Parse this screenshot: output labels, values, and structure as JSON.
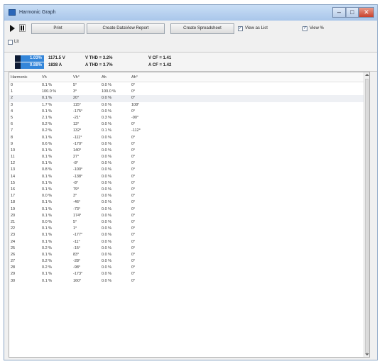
{
  "window": {
    "title": "Harmonic Graph"
  },
  "title_controls": {
    "minimize": "–",
    "maximize": "□",
    "close": "✕"
  },
  "toolbar": {
    "print_label": "Print",
    "dataview_label": "Create DataView Report",
    "spreadsheet_label": "Create Spreadsheet",
    "view_as_list_label": "View as List",
    "view_as_list_checked": "✓",
    "view_pct_label": "View %",
    "view_pct_checked": "✓",
    "extra_label": "Lit",
    "extra_checked": ""
  },
  "readout": {
    "voltage_pct": "1.03%",
    "current_pct": "0.88%",
    "voltage_val": "1171.5 V",
    "current_val": "1838 A",
    "v_thd": "V THD = 3.2%",
    "a_thd": "A THD = 3.7%",
    "v_cf": "V CF = 1.41",
    "a_cf": "A CF = 1.42",
    "colors": {
      "dark": "#0d1a33",
      "accent": "#3486d9"
    }
  },
  "table": {
    "columns": [
      "Harmonic",
      "Vh",
      "Vh°",
      "Ah",
      "Ah°"
    ],
    "rows": [
      [
        "0",
        "0.1 %",
        "5°",
        "0.0 %",
        "0°"
      ],
      [
        "1",
        "100.0 %",
        "3°",
        "100.0 %",
        "0°"
      ],
      [
        "2",
        "0.1 %",
        "20°",
        "0.0 %",
        "0°"
      ],
      [
        "3",
        "1.7 %",
        "115°",
        "0.0 %",
        "108°"
      ],
      [
        "4",
        "0.1 %",
        "-175°",
        "0.0 %",
        "0°"
      ],
      [
        "5",
        "2.1 %",
        "-21°",
        "0.3 %",
        "-90°"
      ],
      [
        "6",
        "0.2 %",
        "13°",
        "0.0 %",
        "0°"
      ],
      [
        "7",
        "0.2 %",
        "132°",
        "0.1 %",
        "-112°"
      ],
      [
        "8",
        "0.1 %",
        "-111°",
        "0.0 %",
        "0°"
      ],
      [
        "9",
        "0.6 %",
        "-170°",
        "0.0 %",
        "0°"
      ],
      [
        "10",
        "0.1 %",
        "140°",
        "0.0 %",
        "0°"
      ],
      [
        "11",
        "0.1 %",
        "27°",
        "0.0 %",
        "0°"
      ],
      [
        "12",
        "0.1 %",
        "-8°",
        "0.0 %",
        "0°"
      ],
      [
        "13",
        "0.8 %",
        "-100°",
        "0.0 %",
        "0°"
      ],
      [
        "14",
        "0.1 %",
        "-138°",
        "0.0 %",
        "0°"
      ],
      [
        "15",
        "0.1 %",
        "-8°",
        "0.0 %",
        "0°"
      ],
      [
        "16",
        "0.1 %",
        "79°",
        "0.0 %",
        "0°"
      ],
      [
        "17",
        "0.0 %",
        "3°",
        "0.0 %",
        "0°"
      ],
      [
        "18",
        "0.1 %",
        "-46°",
        "0.0 %",
        "0°"
      ],
      [
        "19",
        "0.1 %",
        "-73°",
        "0.0 %",
        "0°"
      ],
      [
        "20",
        "0.1 %",
        "174°",
        "0.0 %",
        "0°"
      ],
      [
        "21",
        "0.0 %",
        "5°",
        "0.0 %",
        "0°"
      ],
      [
        "22",
        "0.1 %",
        "1°",
        "0.0 %",
        "0°"
      ],
      [
        "23",
        "0.1 %",
        "-177°",
        "0.0 %",
        "0°"
      ],
      [
        "24",
        "0.1 %",
        "-11°",
        "0.0 %",
        "0°"
      ],
      [
        "25",
        "0.2 %",
        "-15°",
        "0.0 %",
        "0°"
      ],
      [
        "26",
        "0.1 %",
        "83°",
        "0.0 %",
        "0°"
      ],
      [
        "27",
        "0.2 %",
        "-28°",
        "0.0 %",
        "0°"
      ],
      [
        "28",
        "0.2 %",
        "-98°",
        "0.0 %",
        "0°"
      ],
      [
        "29",
        "0.1 %",
        "-173°",
        "0.0 %",
        "0°"
      ],
      [
        "30",
        "0.1 %",
        "160°",
        "0.0 %",
        "0°"
      ]
    ]
  }
}
